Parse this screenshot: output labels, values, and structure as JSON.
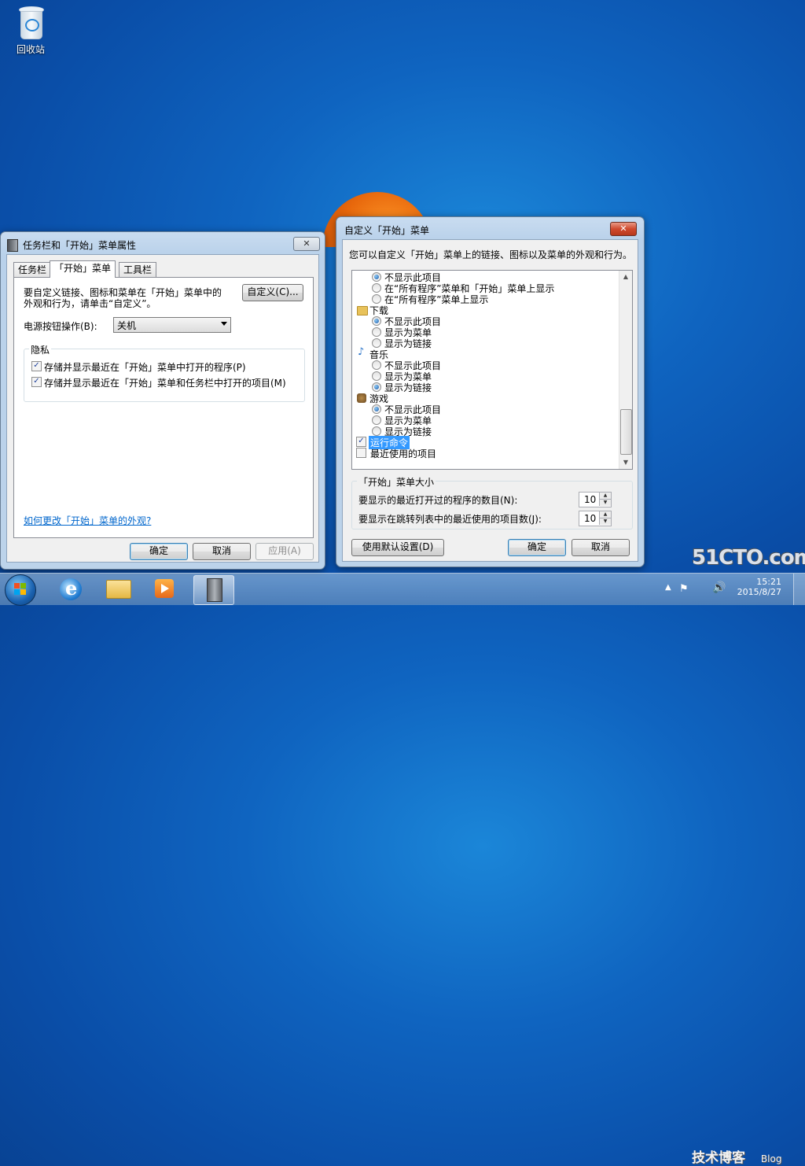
{
  "desktop": {
    "recycle_bin_label": "回收站"
  },
  "taskbar_props": {
    "title": "任务栏和「开始」菜单属性",
    "tabs": [
      "任务栏",
      "「开始」菜单",
      "工具栏"
    ],
    "description": [
      "要自定义链接、图标和菜单在「开始」菜单中的",
      "外观和行为，请单击“自定义”。"
    ],
    "customize_button": "自定义(C)...",
    "power_label": "电源按钮操作(B):",
    "power_value": "关机",
    "privacy_label": "隐私",
    "privacy_items": [
      {
        "label": "存储并显示最近在「开始」菜单中打开的程序(P)",
        "checked": true
      },
      {
        "label": "存储并显示最近在「开始」菜单和任务栏中打开的项目(M)",
        "checked": true
      }
    ],
    "help_link": "如何更改「开始」菜单的外观?",
    "ok": "确定",
    "cancel": "取消",
    "apply": "应用(A)"
  },
  "customize": {
    "title": "自定义「开始」菜单",
    "description": "您可以自定义「开始」菜单上的链接、图标以及菜单的外观和行为。",
    "list": [
      {
        "type": "radio",
        "label": "不显示此项目",
        "on": true
      },
      {
        "type": "radio",
        "label": "在“所有程序”菜单和「开始」菜单上显示",
        "on": false
      },
      {
        "type": "radio",
        "label": "在“所有程序”菜单上显示",
        "on": false
      },
      {
        "type": "header",
        "label": "下载",
        "icon": "folder-icon"
      },
      {
        "type": "radio",
        "label": "不显示此项目",
        "on": true
      },
      {
        "type": "radio",
        "label": "显示为菜单",
        "on": false
      },
      {
        "type": "radio",
        "label": "显示为链接",
        "on": false
      },
      {
        "type": "header",
        "label": "音乐",
        "icon": "music-icon"
      },
      {
        "type": "radio",
        "label": "不显示此项目",
        "on": false
      },
      {
        "type": "radio",
        "label": "显示为菜单",
        "on": false
      },
      {
        "type": "radio",
        "label": "显示为链接",
        "on": true
      },
      {
        "type": "header",
        "label": "游戏",
        "icon": "game-icon"
      },
      {
        "type": "radio",
        "label": "不显示此项目",
        "on": true
      },
      {
        "type": "radio",
        "label": "显示为菜单",
        "on": false
      },
      {
        "type": "radio",
        "label": "显示为链接",
        "on": false
      },
      {
        "type": "check",
        "label": "运行命令",
        "checked": true,
        "selected": true
      },
      {
        "type": "check",
        "label": "最近使用的项目",
        "checked": false,
        "selected": false
      }
    ],
    "size_group": "「开始」菜单大小",
    "recent_programs_label": "要显示的最近打开过的程序的数目(N):",
    "recent_programs_value": "10",
    "jump_list_label": "要显示在跳转列表中的最近使用的项目数(J):",
    "jump_list_value": "10",
    "defaults_button": "使用默认设置(D)",
    "ok": "确定",
    "cancel": "取消"
  },
  "tray": {
    "time": "15:21",
    "date": "2015/8/27"
  },
  "watermark": {
    "line1": "51CTO.com",
    "line2": "技术博客",
    "line3": "Blog"
  }
}
